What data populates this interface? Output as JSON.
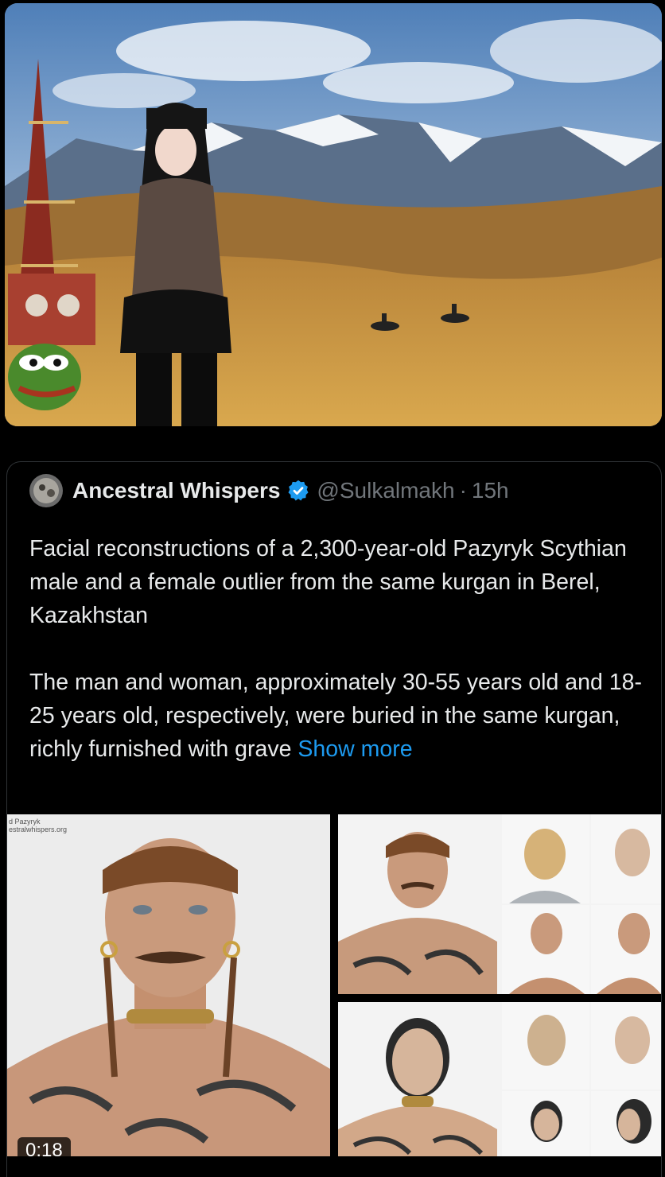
{
  "post": {
    "author_name": "Ancestral Whispers",
    "handle": "@Sulkalmakh",
    "separator": "·",
    "time": "15h",
    "text_para1": "Facial reconstructions of a 2,300-year-old Pazyryk Scythian male and a female outlier from the same kurgan in Berel, Kazakhstan",
    "text_para2": "The man and woman, approximately 30-55 years old and 18-25 years old, respectively, were buried in the same kurgan, richly furnished with grave",
    "show_more": "Show more",
    "video_duration": "0:18",
    "watermark_line1": "d Pazyryk",
    "watermark_line2": "estralwhispers.org"
  },
  "icons": {
    "verified": "verified-badge-icon"
  },
  "colors": {
    "background": "#000000",
    "text": "#e7e9ea",
    "muted": "#71767b",
    "link": "#1d9bf0",
    "border": "#2f3336"
  }
}
